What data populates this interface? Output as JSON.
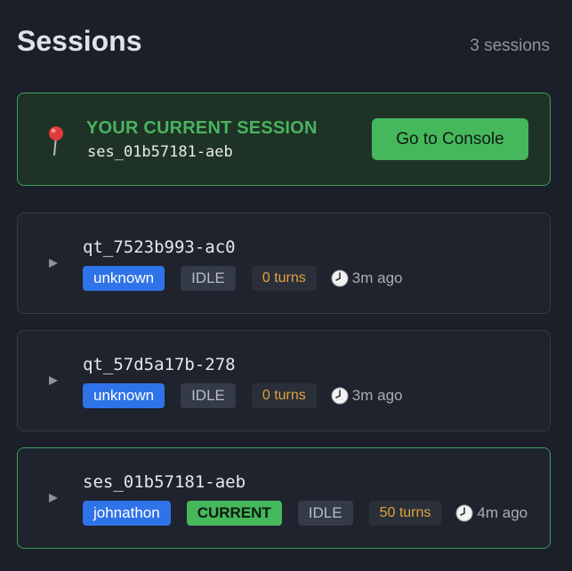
{
  "header": {
    "title": "Sessions",
    "count_label": "3 sessions"
  },
  "current_session": {
    "label": "YOUR CURRENT SESSION",
    "id": "ses_01b57181-aeb",
    "button_label": "Go to Console",
    "icon": "pin-icon"
  },
  "sessions": [
    {
      "id": "qt_7523b993-ac0",
      "user": "unknown",
      "current_badge": "",
      "status": "IDLE",
      "turns": "0 turns",
      "ago": "3m ago"
    },
    {
      "id": "qt_57d5a17b-278",
      "user": "unknown",
      "current_badge": "",
      "status": "IDLE",
      "turns": "0 turns",
      "ago": "3m ago"
    },
    {
      "id": "ses_01b57181-aeb",
      "user": "johnathon",
      "current_badge": "CURRENT",
      "status": "IDLE",
      "turns": "50 turns",
      "ago": "4m ago"
    }
  ],
  "colors": {
    "background": "#1b1f29",
    "accent_green": "#45b85c",
    "user_badge_blue": "#2f73e8",
    "turns_orange": "#e1a23a"
  }
}
